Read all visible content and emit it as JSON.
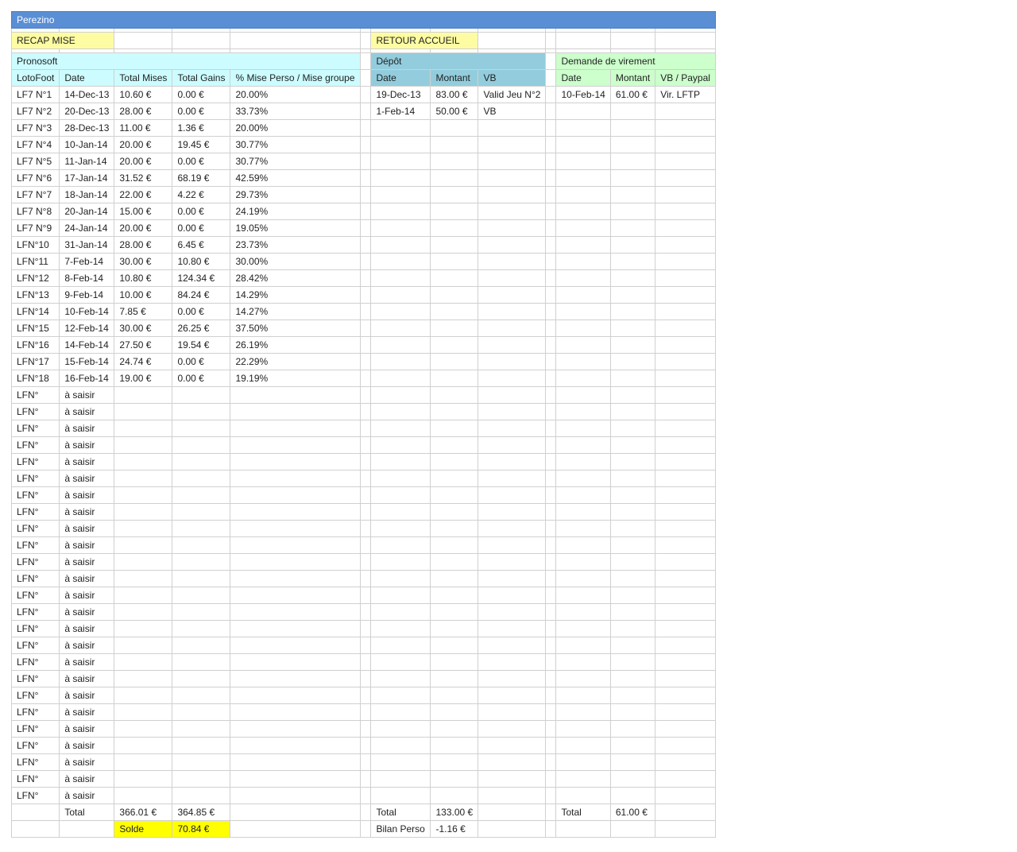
{
  "sheet": {
    "title": "Perezino",
    "recap_label": "RECAP MISE",
    "retour_label": "RETOUR ACCUEIL"
  },
  "pronosoft": {
    "section_label": "Pronosoft",
    "headers": [
      "LotoFoot",
      "Date",
      "Total Mises",
      "Total Gains",
      "% Mise Perso / Mise groupe"
    ],
    "rows": [
      [
        "LF7 N°1",
        "14-Dec-13",
        "10.60 €",
        "0.00 €",
        "20.00%"
      ],
      [
        "LF7 N°2",
        "20-Dec-13",
        "28.00 €",
        "0.00 €",
        "33.73%"
      ],
      [
        "LF7 N°3",
        "28-Dec-13",
        "11.00 €",
        "1.36 €",
        "20.00%"
      ],
      [
        "LF7 N°4",
        "10-Jan-14",
        "20.00 €",
        "19.45 €",
        "30.77%"
      ],
      [
        "LF7 N°5",
        "11-Jan-14",
        "20.00 €",
        "0.00 €",
        "30.77%"
      ],
      [
        "LF7 N°6",
        "17-Jan-14",
        "31.52 €",
        "68.19 €",
        "42.59%"
      ],
      [
        "LF7 N°7",
        "18-Jan-14",
        "22.00 €",
        "4.22 €",
        "29.73%"
      ],
      [
        "LF7 N°8",
        "20-Jan-14",
        "15.00 €",
        "0.00 €",
        "24.19%"
      ],
      [
        "LF7 N°9",
        "24-Jan-14",
        "20.00 €",
        "0.00 €",
        "19.05%"
      ],
      [
        "LFN°10",
        "31-Jan-14",
        "28.00 €",
        "6.45 €",
        "23.73%"
      ],
      [
        "LFN°11",
        "7-Feb-14",
        "30.00 €",
        "10.80 €",
        "30.00%"
      ],
      [
        "LFN°12",
        "8-Feb-14",
        "10.80 €",
        "124.34 €",
        "28.42%"
      ],
      [
        "LFN°13",
        "9-Feb-14",
        "10.00 €",
        "84.24 €",
        "14.29%"
      ],
      [
        "LFN°14",
        "10-Feb-14",
        "7.85 €",
        "0.00 €",
        "14.27%"
      ],
      [
        "LFN°15",
        "12-Feb-14",
        "30.00 €",
        "26.25 €",
        "37.50%"
      ],
      [
        "LFN°16",
        "14-Feb-14",
        "27.50 €",
        "19.54 €",
        "26.19%"
      ],
      [
        "LFN°17",
        "15-Feb-14",
        "24.74 €",
        "0.00 €",
        "22.29%"
      ],
      [
        "LFN°18",
        "16-Feb-14",
        "19.00 €",
        "0.00 €",
        "19.19%"
      ],
      [
        "LFN°",
        "à saisir",
        "",
        "",
        ""
      ],
      [
        "LFN°",
        "à saisir",
        "",
        "",
        ""
      ],
      [
        "LFN°",
        "à saisir",
        "",
        "",
        ""
      ],
      [
        "LFN°",
        "à saisir",
        "",
        "",
        ""
      ],
      [
        "LFN°",
        "à saisir",
        "",
        "",
        ""
      ],
      [
        "LFN°",
        "à saisir",
        "",
        "",
        ""
      ],
      [
        "LFN°",
        "à saisir",
        "",
        "",
        ""
      ],
      [
        "LFN°",
        "à saisir",
        "",
        "",
        ""
      ],
      [
        "LFN°",
        "à saisir",
        "",
        "",
        ""
      ],
      [
        "LFN°",
        "à saisir",
        "",
        "",
        ""
      ],
      [
        "LFN°",
        "à saisir",
        "",
        "",
        ""
      ],
      [
        "LFN°",
        "à saisir",
        "",
        "",
        ""
      ],
      [
        "LFN°",
        "à saisir",
        "",
        "",
        ""
      ],
      [
        "LFN°",
        "à saisir",
        "",
        "",
        ""
      ],
      [
        "LFN°",
        "à saisir",
        "",
        "",
        ""
      ],
      [
        "LFN°",
        "à saisir",
        "",
        "",
        ""
      ],
      [
        "LFN°",
        "à saisir",
        "",
        "",
        ""
      ],
      [
        "LFN°",
        "à saisir",
        "",
        "",
        ""
      ],
      [
        "LFN°",
        "à saisir",
        "",
        "",
        ""
      ],
      [
        "LFN°",
        "à saisir",
        "",
        "",
        ""
      ],
      [
        "LFN°",
        "à saisir",
        "",
        "",
        ""
      ],
      [
        "LFN°",
        "à saisir",
        "",
        "",
        ""
      ],
      [
        "LFN°",
        "à saisir",
        "",
        "",
        ""
      ],
      [
        "LFN°",
        "à saisir",
        "",
        "",
        ""
      ],
      [
        "LFN°",
        "à saisir",
        "",
        "",
        ""
      ]
    ],
    "total_label": "Total",
    "total_mises": "366.01 €",
    "total_gains": "364.85 €",
    "solde_label": "Solde",
    "solde_value": "70.84 €"
  },
  "depot": {
    "section_label": "Dépôt",
    "headers": [
      "Date",
      "Montant",
      "VB"
    ],
    "rows": [
      [
        "19-Dec-13",
        "83.00 €",
        "Valid Jeu N°2"
      ],
      [
        "1-Feb-14",
        "50.00 €",
        "VB"
      ]
    ],
    "total_label": "Total",
    "total_value": "133.00 €",
    "bilan_label": "Bilan Perso",
    "bilan_value": "-1.16 €"
  },
  "virement": {
    "section_label": "Demande de virement",
    "headers": [
      "Date",
      "Montant",
      "VB / Paypal"
    ],
    "rows": [
      [
        "10-Feb-14",
        "61.00 €",
        "Vir. LFTP"
      ]
    ],
    "total_label": "Total",
    "total_value": "61.00 €"
  },
  "colors": {
    "title_bar": "#5a8fd6",
    "pronosoft_header": "#ccfcff",
    "depot_header": "#93cddd",
    "virement_header": "#ccffcc",
    "recap_cell": "#fdfca2",
    "solde_cell": "#ffff00"
  }
}
